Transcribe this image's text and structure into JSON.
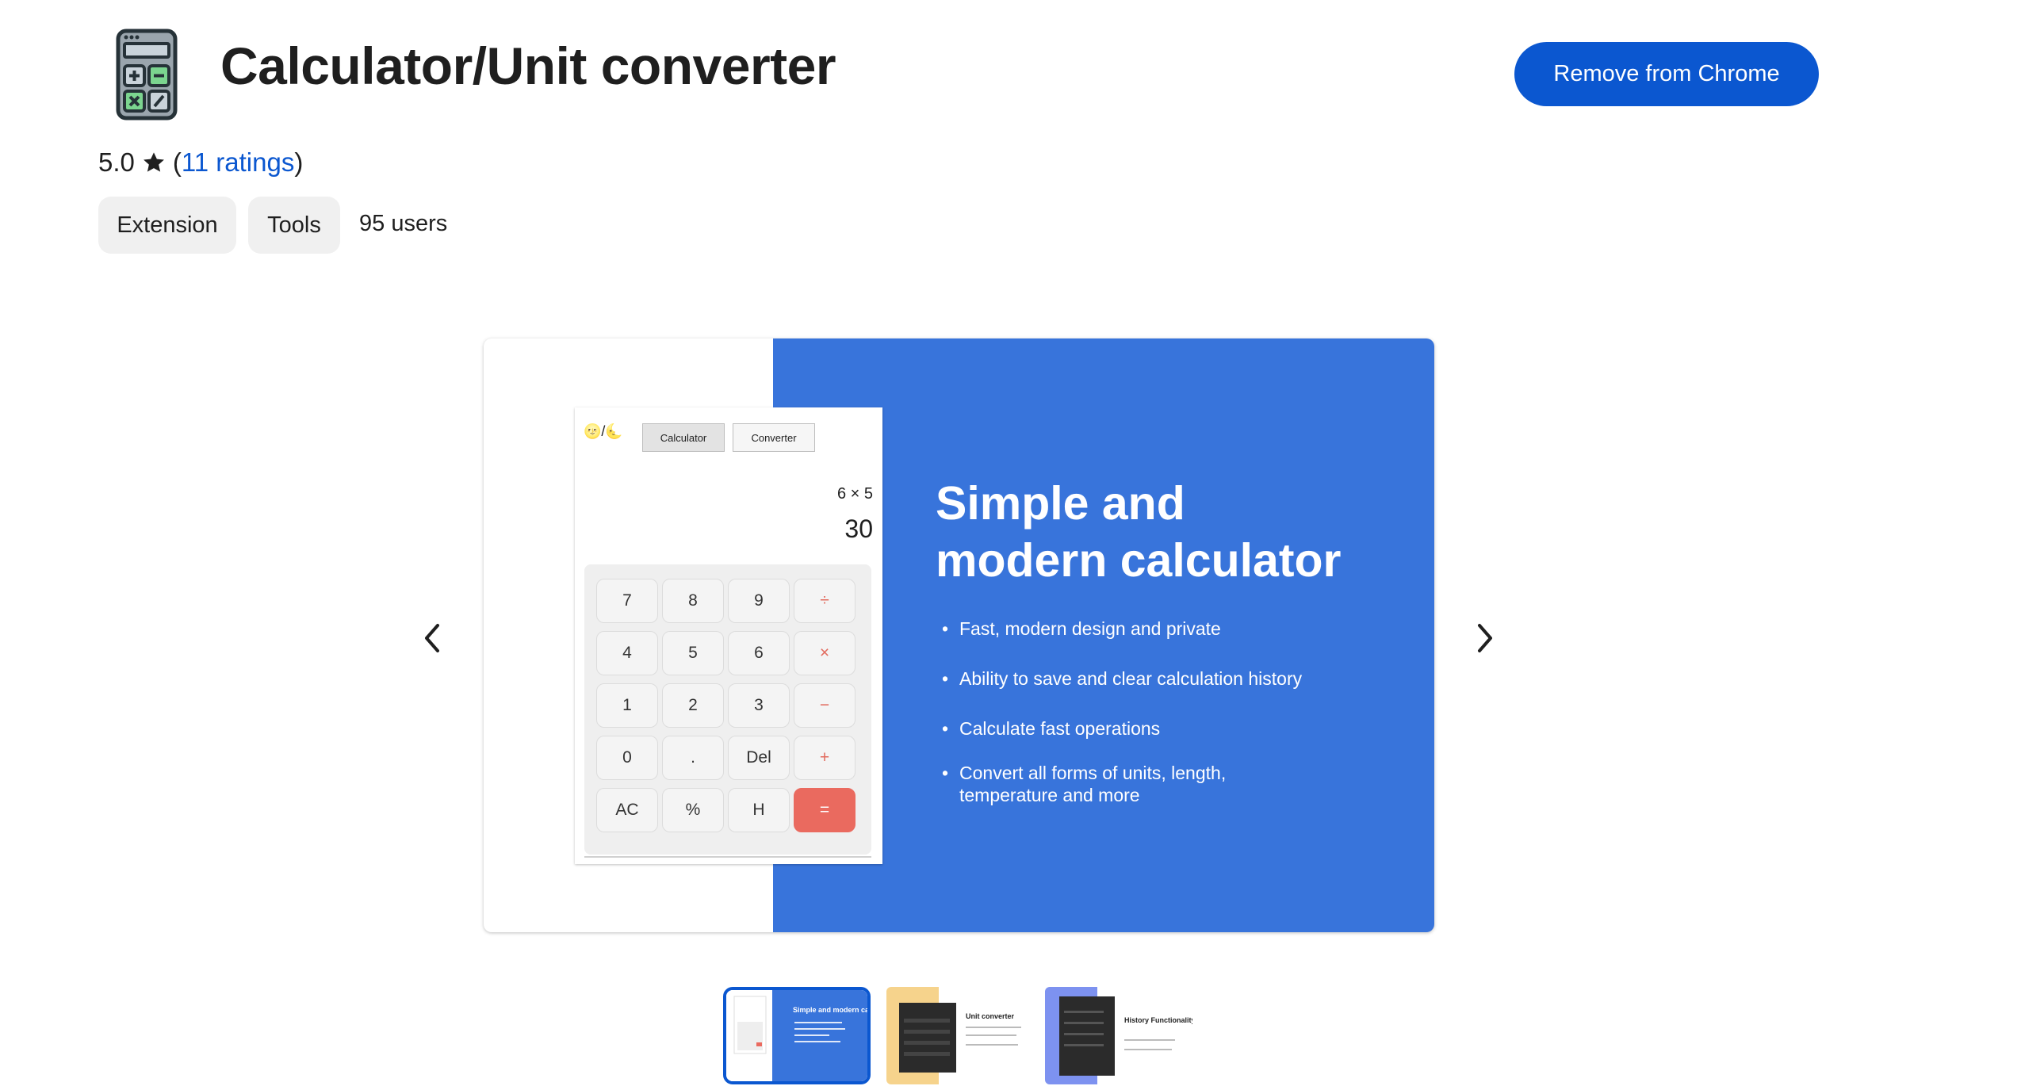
{
  "extension": {
    "title": "Calculator/Unit converter",
    "icon": "calculator-icon",
    "rating": "5.0",
    "rating_open": "(",
    "ratings_link": "11 ratings",
    "rating_close": ")",
    "type_chip": "Extension",
    "category_chip": "Tools",
    "users": "95 users"
  },
  "actions": {
    "remove_label": "Remove from Chrome"
  },
  "colors": {
    "accent": "#0b57d0",
    "slide_blue": "#3874db",
    "equals_key": "#ea6a5f"
  },
  "carousel": {
    "prev_icon": "chevron-left-icon",
    "next_icon": "chevron-right-icon",
    "active_index": 0,
    "slide": {
      "heading_line1": "Simple and",
      "heading_line2": "modern calculator",
      "bullets": [
        "Fast, modern design and private",
        "Ability to save and clear calculation history",
        "Calculate fast operations",
        "Convert all forms of units, length, temperature and more"
      ],
      "calculator": {
        "theme_toggle": "🌝/🌜",
        "tabs": [
          "Calculator",
          "Converter"
        ],
        "expression": "6 × 5",
        "result": "30",
        "keys": [
          "7",
          "8",
          "9",
          "÷",
          "4",
          "5",
          "6",
          "×",
          "1",
          "2",
          "3",
          "−",
          "0",
          ".",
          "Del",
          "+",
          "AC",
          "%",
          "H",
          "="
        ]
      }
    },
    "thumbnails": [
      {
        "title": "Simple and modern calculator"
      },
      {
        "title": "Unit converter"
      },
      {
        "title": "History Functionality"
      }
    ]
  }
}
